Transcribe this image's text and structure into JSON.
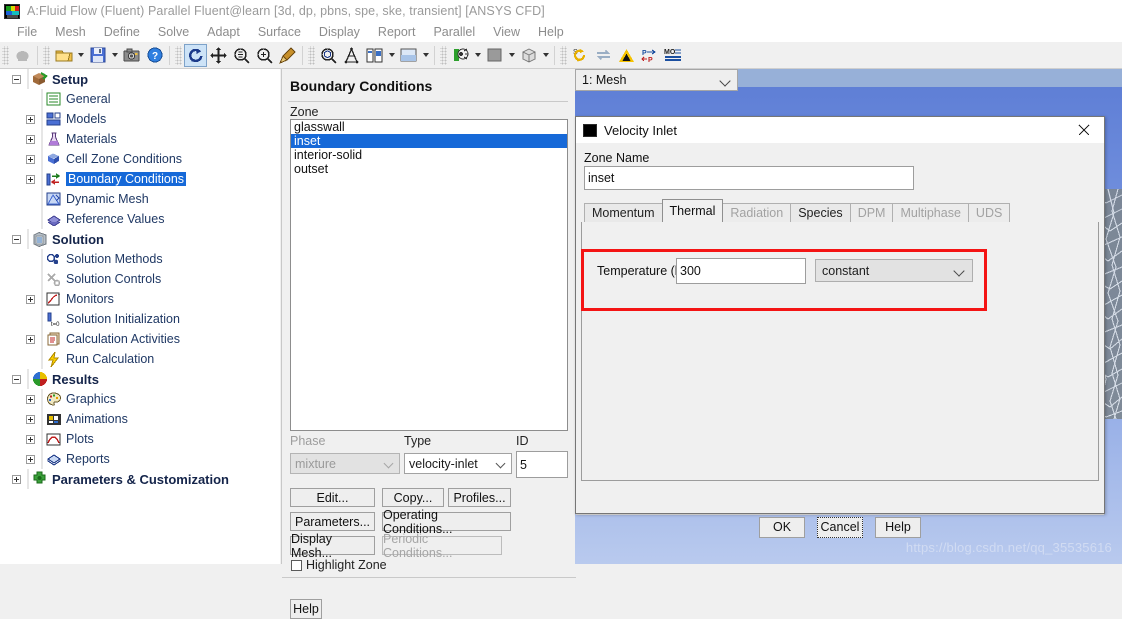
{
  "window": {
    "title": "A:Fluid Flow (Fluent) Parallel Fluent@learn  [3d, dp, pbns, spe, ske, transient] [ANSYS CFD]",
    "icon": "ansys-fluent-icon"
  },
  "menubar": {
    "items": [
      "File",
      "Mesh",
      "Define",
      "Solve",
      "Adapt",
      "Surface",
      "Display",
      "Report",
      "Parallel",
      "View",
      "Help"
    ]
  },
  "toolbar": {
    "groups": [
      {
        "items": [
          {
            "name": "select-cursor-icon",
            "label": "",
            "arrow": false,
            "selected": false
          }
        ]
      },
      {
        "items": [
          {
            "name": "open-folder-icon",
            "label": "",
            "arrow": true,
            "selected": false
          },
          {
            "name": "save-disk-icon",
            "label": "",
            "arrow": true,
            "selected": false
          },
          {
            "name": "camera-icon",
            "label": "",
            "arrow": false,
            "selected": false
          },
          {
            "name": "help-question-icon",
            "label": "",
            "arrow": false,
            "selected": false
          }
        ]
      },
      {
        "items": [
          {
            "name": "rotate-view-icon",
            "label": "",
            "arrow": false,
            "selected": true
          },
          {
            "name": "pan-move-icon",
            "label": "",
            "arrow": false,
            "selected": false
          },
          {
            "name": "zoom-out-icon",
            "label": "",
            "arrow": false,
            "selected": false
          },
          {
            "name": "zoom-in-icon",
            "label": "",
            "arrow": false,
            "selected": false
          },
          {
            "name": "probe-pick-icon",
            "label": "",
            "arrow": false,
            "selected": false
          }
        ]
      },
      {
        "items": [
          {
            "name": "fit-to-window-icon",
            "label": "",
            "arrow": false,
            "selected": false
          },
          {
            "name": "mesh-display-icon",
            "label": "",
            "arrow": false,
            "selected": false
          },
          {
            "name": "layout-panels-icon",
            "label": "",
            "arrow": true,
            "selected": false
          },
          {
            "name": "background-color-icon",
            "label": "",
            "arrow": true,
            "selected": false
          }
        ]
      },
      {
        "items": [
          {
            "name": "lighting-icon",
            "label": "",
            "arrow": true,
            "selected": false
          },
          {
            "name": "color-swatch-icon",
            "label": "",
            "arrow": true,
            "selected": false
          },
          {
            "name": "render-cube-icon",
            "label": "",
            "arrow": true,
            "selected": false
          }
        ]
      },
      {
        "items": [
          {
            "name": "sync-solution-icon",
            "label": "",
            "arrow": false,
            "selected": false
          },
          {
            "name": "refresh-icon",
            "label": "",
            "arrow": false,
            "selected": false
          },
          {
            "name": "ansys-logo-icon",
            "label": "",
            "arrow": false,
            "selected": false
          },
          {
            "name": "pressure-profile-icon",
            "label": "",
            "arrow": false,
            "selected": false
          },
          {
            "name": "monitor-plot-icon",
            "label": "",
            "arrow": false,
            "selected": false
          }
        ]
      }
    ]
  },
  "tree": {
    "nodes": [
      {
        "label": "Setup",
        "depth": 0,
        "expander": "minus",
        "icon": "setup-box-icon",
        "bold": true,
        "selected": false
      },
      {
        "label": "General",
        "depth": 1,
        "expander": "none",
        "icon": "general-list-icon",
        "bold": false,
        "selected": false
      },
      {
        "label": "Models",
        "depth": 1,
        "expander": "plus",
        "icon": "models-blocks-icon",
        "bold": false,
        "selected": false
      },
      {
        "label": "Materials",
        "depth": 1,
        "expander": "plus",
        "icon": "materials-flask-icon",
        "bold": false,
        "selected": false
      },
      {
        "label": "Cell Zone Conditions",
        "depth": 1,
        "expander": "plus",
        "icon": "cell-zone-box-icon",
        "bold": false,
        "selected": false
      },
      {
        "label": "Boundary Conditions",
        "depth": 1,
        "expander": "plus",
        "icon": "boundary-conditions-icon",
        "bold": false,
        "selected": true
      },
      {
        "label": "Dynamic Mesh",
        "depth": 1,
        "expander": "none",
        "icon": "dynamic-mesh-icon",
        "bold": false,
        "selected": false
      },
      {
        "label": "Reference Values",
        "depth": 1,
        "expander": "none",
        "icon": "reference-values-icon",
        "bold": false,
        "selected": false
      },
      {
        "label": "Solution",
        "depth": 0,
        "expander": "minus",
        "icon": "solution-icon",
        "bold": true,
        "selected": false
      },
      {
        "label": "Solution Methods",
        "depth": 1,
        "expander": "none",
        "icon": "solution-methods-icon",
        "bold": false,
        "selected": false
      },
      {
        "label": "Solution Controls",
        "depth": 1,
        "expander": "none",
        "icon": "solution-controls-icon",
        "bold": false,
        "selected": false
      },
      {
        "label": "Monitors",
        "depth": 1,
        "expander": "plus",
        "icon": "monitors-icon",
        "bold": false,
        "selected": false
      },
      {
        "label": "Solution Initialization",
        "depth": 1,
        "expander": "none",
        "icon": "solution-initialization-icon",
        "bold": false,
        "selected": false
      },
      {
        "label": "Calculation Activities",
        "depth": 1,
        "expander": "plus",
        "icon": "calculation-activities-icon",
        "bold": false,
        "selected": false
      },
      {
        "label": "Run Calculation",
        "depth": 1,
        "expander": "none",
        "icon": "run-calculation-lightning-icon",
        "bold": false,
        "selected": false
      },
      {
        "label": "Results",
        "depth": 0,
        "expander": "minus",
        "icon": "results-sphere-icon",
        "bold": true,
        "selected": false
      },
      {
        "label": "Graphics",
        "depth": 1,
        "expander": "plus",
        "icon": "graphics-palette-icon",
        "bold": false,
        "selected": false
      },
      {
        "label": "Animations",
        "depth": 1,
        "expander": "plus",
        "icon": "animations-film-icon",
        "bold": false,
        "selected": false
      },
      {
        "label": "Plots",
        "depth": 1,
        "expander": "plus",
        "icon": "plots-curve-icon",
        "bold": false,
        "selected": false
      },
      {
        "label": "Reports",
        "depth": 1,
        "expander": "plus",
        "icon": "reports-icon",
        "bold": false,
        "selected": false
      },
      {
        "label": "Parameters & Customization",
        "depth": 0,
        "expander": "plus",
        "icon": "parameters-puzzle-icon",
        "bold": true,
        "selected": false
      }
    ]
  },
  "boundary_conditions": {
    "title": "Boundary Conditions",
    "zone_label": "Zone",
    "zones": [
      "glasswall",
      "inset",
      "interior-solid",
      "outset"
    ],
    "selected_zone": "inset",
    "phase_label": "Phase",
    "phase_value": "mixture",
    "type_label": "Type",
    "type_value": "velocity-inlet",
    "id_label": "ID",
    "id_value": "5",
    "buttons": {
      "edit": "Edit...",
      "copy": "Copy...",
      "profiles": "Profiles...",
      "parameters": "Parameters...",
      "operating_conditions": "Operating Conditions...",
      "display_mesh": "Display Mesh...",
      "periodic_conditions": "Periodic Conditions...",
      "help": "Help"
    },
    "highlight_zone_label": "Highlight Zone",
    "highlight_zone_checked": false
  },
  "graphics": {
    "view_selector": "1: Mesh",
    "watermark": "https://blog.csdn.net/qq_35535616"
  },
  "dialog": {
    "title": "Velocity Inlet",
    "icon": "ansys-fluent-icon",
    "close_icon": "close-icon",
    "zone_name_label": "Zone Name",
    "zone_name_value": "inset",
    "tabs": [
      {
        "label": "Momentum",
        "active": false,
        "disabled": false
      },
      {
        "label": "Thermal",
        "active": true,
        "disabled": false
      },
      {
        "label": "Radiation",
        "active": false,
        "disabled": true
      },
      {
        "label": "Species",
        "active": false,
        "disabled": false
      },
      {
        "label": "DPM",
        "active": false,
        "disabled": true
      },
      {
        "label": "Multiphase",
        "active": false,
        "disabled": true
      },
      {
        "label": "UDS",
        "active": false,
        "disabled": true
      }
    ],
    "thermal": {
      "temperature_label": "Temperature (k)",
      "temperature_value": "300",
      "temperature_mode": "constant",
      "highlight_color": "#f41414"
    },
    "buttons": {
      "ok": "OK",
      "cancel": "Cancel",
      "help": "Help"
    }
  },
  "colors": {
    "selection_blue": "#1669d8",
    "highlight_red": "#f41414",
    "graphics_background": "#6e8ede"
  }
}
